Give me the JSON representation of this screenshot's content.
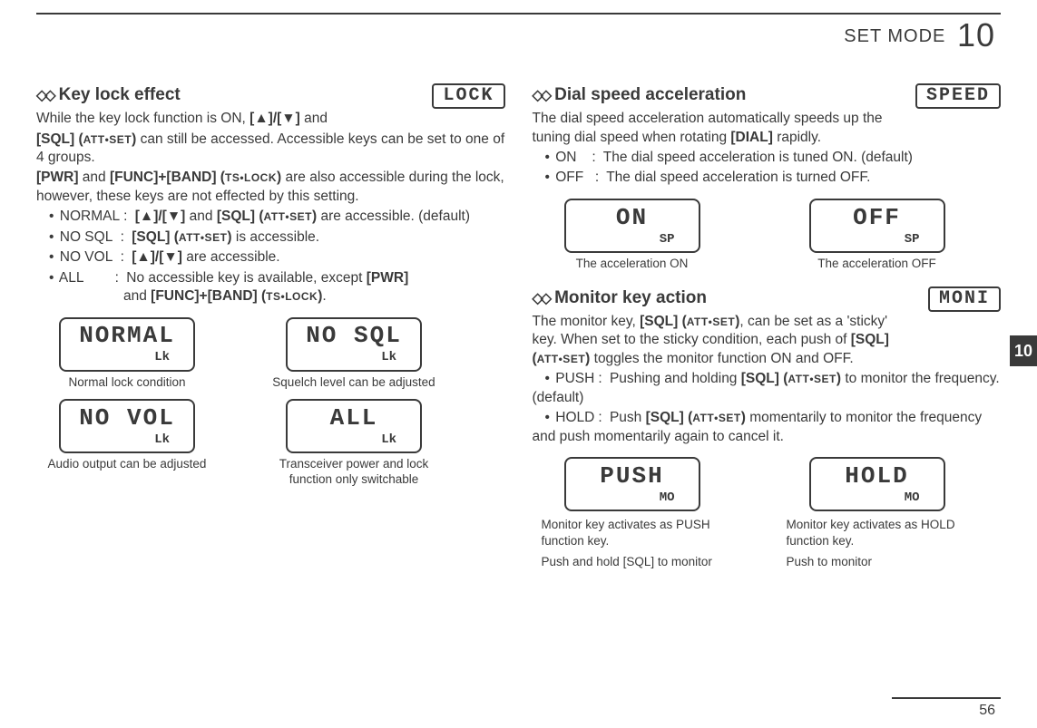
{
  "header": {
    "mode_label": "SET MODE",
    "chapter": "10"
  },
  "tab": {
    "number": "10"
  },
  "footer": {
    "page": "56"
  },
  "left": {
    "keylock": {
      "title": "Key lock effect",
      "lcd_label": "LOCK",
      "intro_1": "While the key lock function is ON, ",
      "intro_keys": "[▲]/[▼]",
      "intro_2": " and ",
      "intro_sql": "[SQL] (",
      "intro_sql_sc": "ATT•SET",
      "intro_sql_close": ")",
      "intro_3": " can still be accessed. Accessible keys can be set to one of 4 groups.",
      "pwr_line_1": "[PWR]",
      "pwr_line_2": " and ",
      "pwr_line_3": "[FUNC]+[BAND] (",
      "pwr_line_sc": "TS•LOCK",
      "pwr_line_close": ")",
      "pwr_line_4": " are also accessible during the lock, however, these keys are not effected by this setting.",
      "opt_normal_name": "NORMAL",
      "opt_normal_desc_1": "[▲]/[▼]",
      "opt_normal_desc_2": " and ",
      "opt_normal_desc_3": "[SQL] (",
      "opt_normal_sc": "ATT•SET",
      "opt_normal_close": ")",
      "opt_normal_desc_4": " are accessible. (default)",
      "opt_nosql_name": "NO SQL",
      "opt_nosql_desc_1": "[SQL] (",
      "opt_nosql_sc": "ATT•SET",
      "opt_nosql_close": ")",
      "opt_nosql_desc_2": " is accessible.",
      "opt_novol_name": "NO VOL",
      "opt_novol_desc_1": "[▲]/[▼]",
      "opt_novol_desc_2": " are accessible.",
      "opt_all_name": "ALL",
      "opt_all_desc_1": "No accessible key is available, except ",
      "opt_all_desc_2": "[PWR]",
      "opt_all_desc_3": " and ",
      "opt_all_desc_4": "[FUNC]+[BAND] (",
      "opt_all_sc": "TS•LOCK",
      "opt_all_close": ")",
      "opt_all_desc_5": ".",
      "figs": {
        "normal": {
          "lcd": "NORMAL",
          "sub": "Lk",
          "caption": "Normal lock condition"
        },
        "nosql": {
          "lcd": "NO SQL",
          "sub": "Lk",
          "caption": "Squelch level can be adjusted"
        },
        "novol": {
          "lcd": "NO VOL",
          "sub": "Lk",
          "caption": "Audio output can be adjusted"
        },
        "all": {
          "lcd": "ALL",
          "sub": "Lk",
          "caption": "Transceiver power and lock function only switchable"
        }
      }
    }
  },
  "right": {
    "dialspeed": {
      "title": "Dial speed acceleration",
      "lcd_label": "SPEED",
      "intro_1": "The dial speed acceleration automatically speeds up the tuning dial speed when rotating ",
      "intro_dial": "[DIAL]",
      "intro_2": " rapidly.",
      "opt_on_name": "ON",
      "opt_on_desc": "The dial speed acceleration is tuned ON. (default)",
      "opt_off_name": "OFF",
      "opt_off_desc": "The dial speed acceleration is turned OFF.",
      "figs": {
        "on": {
          "lcd": "ON",
          "sub": "SP",
          "caption": "The acceleration ON"
        },
        "off": {
          "lcd": "OFF",
          "sub": "SP",
          "caption": "The acceleration OFF"
        }
      }
    },
    "monitor": {
      "title": "Monitor key action",
      "lcd_label": "MONI",
      "intro_1": "The monitor key, ",
      "intro_sql_1": "[SQL] (",
      "intro_sc_1": "ATT•SET",
      "intro_close_1": ")",
      "intro_2": ", can be set as a 'sticky' key. When set to the sticky condition, each push of ",
      "intro_sql_2": "[SQL] (",
      "intro_sc_2": "ATT•SET",
      "intro_close_2": ")",
      "intro_3": " toggles the monitor function ON and OFF.",
      "opt_push_name": "PUSH",
      "opt_push_desc_1": "Pushing and holding ",
      "opt_push_sql": "[SQL] (",
      "opt_push_sc": "ATT•SET",
      "opt_push_close": ")",
      "opt_push_desc_2": " to monitor the frequency. (default)",
      "opt_hold_name": "HOLD",
      "opt_hold_desc_1": "Push ",
      "opt_hold_sql": "[SQL] (",
      "opt_hold_sc": "ATT•SET",
      "opt_hold_close": ")",
      "opt_hold_desc_2": " momentarily to monitor the frequency and push momentarily again to cancel it.",
      "figs": {
        "push": {
          "lcd": "PUSH",
          "sub": "MO",
          "caption_1": "Monitor key activates as PUSH function key.",
          "caption_2": "Push and hold [SQL] to monitor"
        },
        "hold": {
          "lcd": "HOLD",
          "sub": "MO",
          "caption_1": "Monitor key activates as HOLD function key.",
          "caption_2": "Push to monitor"
        }
      }
    }
  }
}
